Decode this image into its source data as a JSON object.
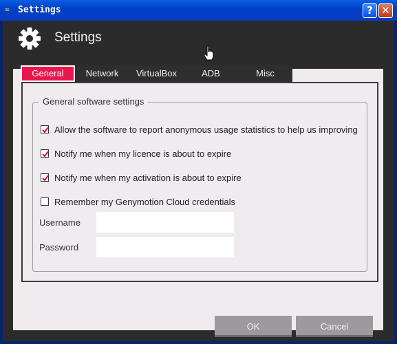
{
  "window": {
    "title": "Settings",
    "help_label": "?",
    "close_label": "✕"
  },
  "header": {
    "title": "Settings"
  },
  "tabs": [
    {
      "label": "General",
      "active": true
    },
    {
      "label": "Network",
      "active": false
    },
    {
      "label": "VirtualBox",
      "active": false
    },
    {
      "label": "ADB",
      "active": false
    },
    {
      "label": "Misc",
      "active": false
    }
  ],
  "general": {
    "group_title": "General software settings",
    "options": [
      {
        "label": "Allow the software to report anonymous usage statistics to help us improving",
        "checked": true
      },
      {
        "label": "Notify me when my licence is about to expire",
        "checked": true
      },
      {
        "label": "Notify me when my activation is about to expire",
        "checked": true
      },
      {
        "label": "Remember my Genymotion Cloud credentials",
        "checked": false
      }
    ],
    "username_label": "Username",
    "username_value": "",
    "password_label": "Password",
    "password_value": ""
  },
  "buttons": {
    "ok": "OK",
    "cancel": "Cancel"
  },
  "colors": {
    "accent": "#e8174e",
    "check": "#c8143c"
  },
  "icons": {
    "header": "gear-icon",
    "title": "app-icon"
  }
}
